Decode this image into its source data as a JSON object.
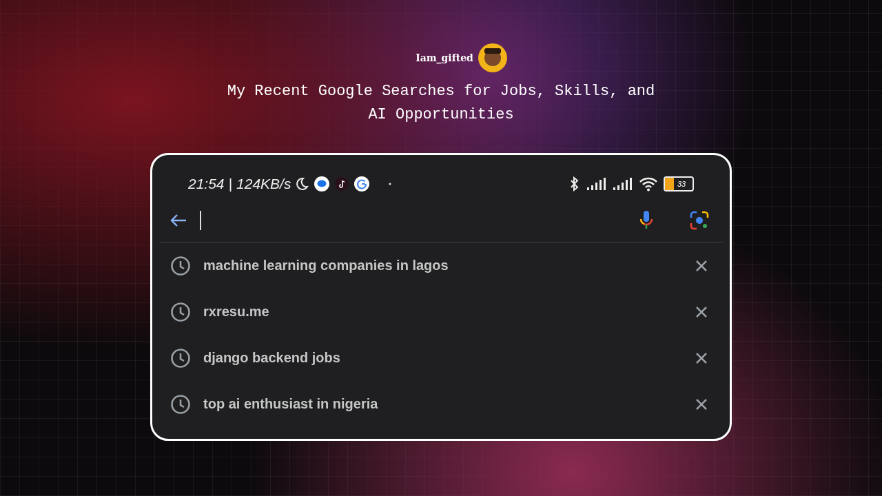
{
  "header": {
    "author": "Iam_gifted",
    "title": "My Recent Google Searches for Jobs, Skills, and AI Opportunities"
  },
  "status_bar": {
    "time": "21:54",
    "separator": "|",
    "speed": "124KB/s",
    "battery": {
      "reading": "33",
      "level": 0.33
    }
  },
  "history": [
    {
      "query": "machine learning companies in lagos"
    },
    {
      "query": "rxresu.me"
    },
    {
      "query": "django backend jobs"
    },
    {
      "query": "top ai enthusiast in nigeria"
    }
  ]
}
